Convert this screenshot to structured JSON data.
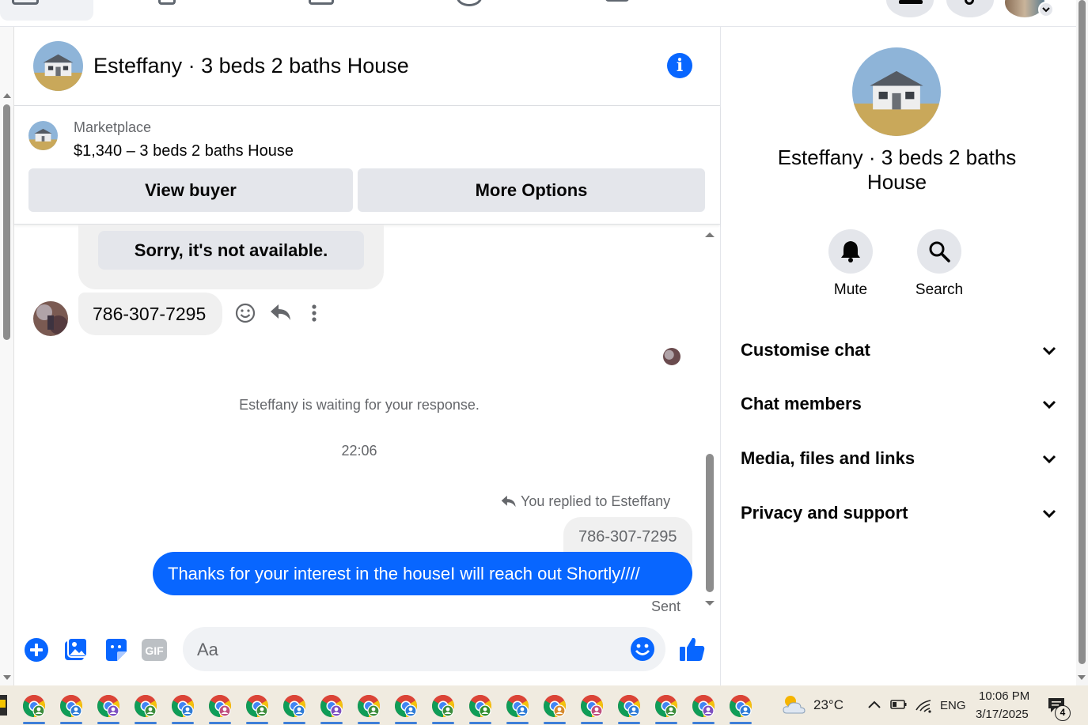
{
  "chat": {
    "title": "Esteffany · 3 beds 2 baths House",
    "marketplace_label": "Marketplace",
    "listing": "$1,340 – 3 beds 2 baths House",
    "view_buyer_label": "View buyer",
    "more_options_label": "More Options"
  },
  "messages": {
    "quick_reply": "Sorry, it's not available.",
    "received_phone": "786-307-7295",
    "waiting_text": "Esteffany is waiting for your response.",
    "timestamp": "22:06",
    "replied_to": "You replied to Esteffany",
    "quoted_phone": "786-307-7295",
    "sent_text": "Thanks for your interest in the houseI will reach out Shortly////",
    "status": "Sent"
  },
  "composer": {
    "placeholder": "Aa"
  },
  "right_panel": {
    "title": "Esteffany · 3 beds 2 baths House",
    "mute_label": "Mute",
    "search_label": "Search",
    "sections": [
      "Customise chat",
      "Chat members",
      "Media, files and links",
      "Privacy and support"
    ]
  },
  "taskbar": {
    "temperature": "23°C",
    "language": "ENG",
    "time": "10:06 PM",
    "date": "3/17/2025",
    "notification_count": "4"
  },
  "colors": {
    "accent": "#0866ff",
    "bubble_grey": "#f0f0f0",
    "button_grey": "#e4e6eb",
    "taskbar": "#f0ebe0"
  }
}
